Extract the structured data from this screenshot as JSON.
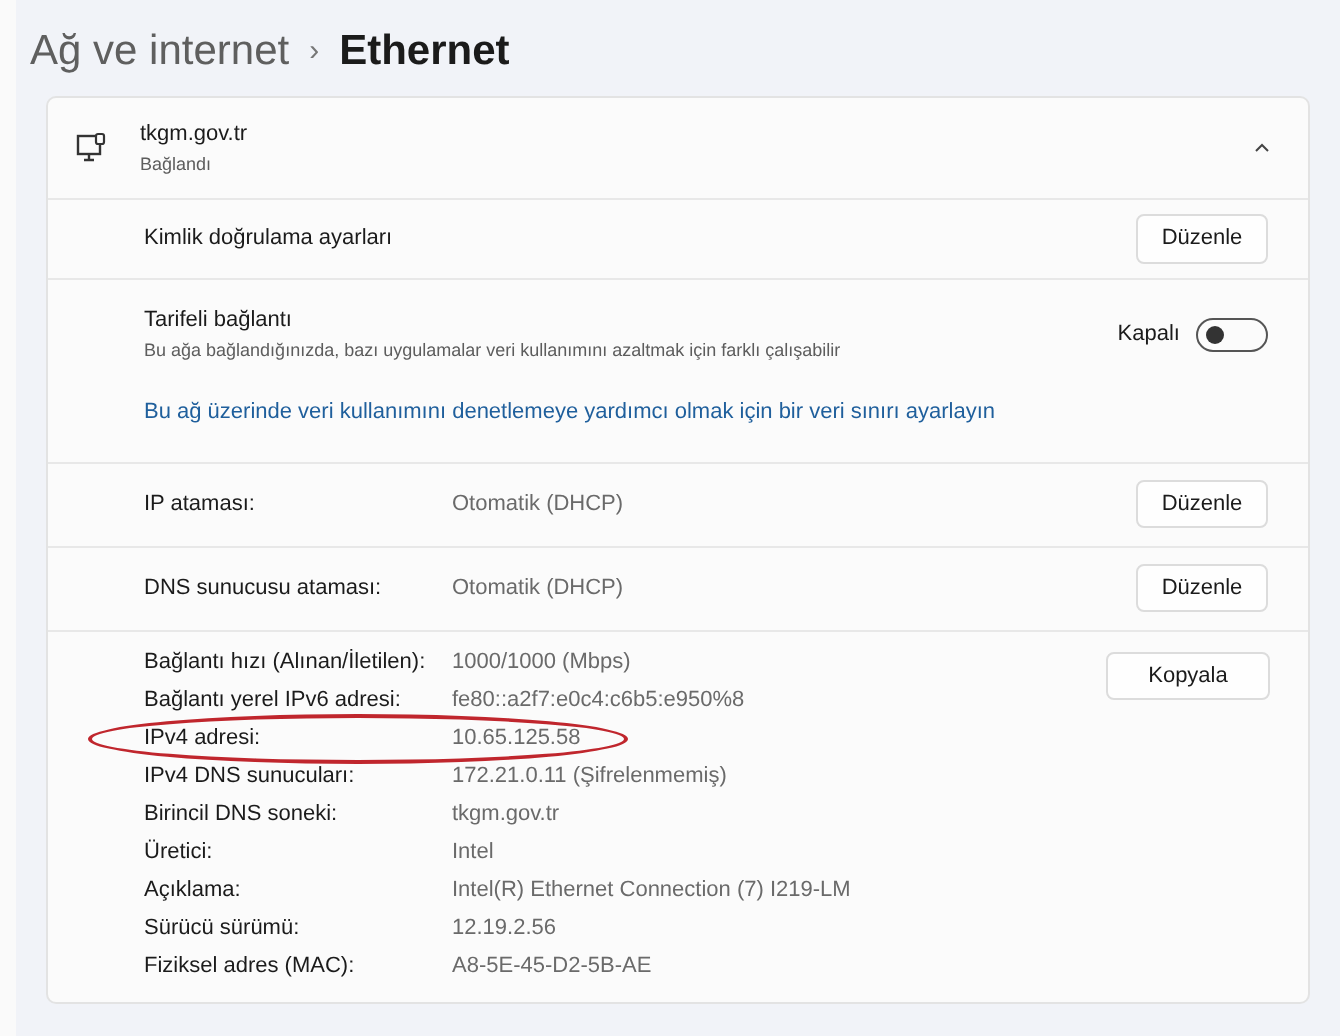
{
  "breadcrumb": {
    "parent": "Ağ ve internet",
    "separator": "›",
    "current": "Ethernet"
  },
  "network": {
    "name": "tkgm.gov.tr",
    "status": "Bağlandı",
    "expanded": true
  },
  "auth": {
    "label": "Kimlik doğrulama ayarları",
    "button": "Düzenle"
  },
  "metered": {
    "label": "Tarifeli bağlantı",
    "description": "Bu ağa bağlandığınızda, bazı uygulamalar veri kullanımını azaltmak için farklı çalışabilir",
    "state_label": "Kapalı",
    "on": false,
    "link": "Bu ağ üzerinde veri kullanımını denetlemeye yardımcı olmak için bir veri sınırı ayarlayın"
  },
  "assignments": [
    {
      "label": "IP ataması:",
      "value": "Otomatik (DHCP)",
      "button": "Düzenle"
    },
    {
      "label": "DNS sunucusu ataması:",
      "value": "Otomatik (DHCP)",
      "button": "Düzenle"
    }
  ],
  "copy_button": "Kopyala",
  "properties": [
    {
      "label": "Bağlantı hızı (Alınan/İletilen):",
      "value": "1000/1000 (Mbps)",
      "circled": false
    },
    {
      "label": "Bağlantı yerel IPv6 adresi:",
      "value": "fe80::a2f7:e0c4:c6b5:e950%8",
      "circled": false
    },
    {
      "label": "IPv4 adresi:",
      "value": "10.65.125.58",
      "circled": true
    },
    {
      "label": "IPv4 DNS sunucuları:",
      "value": "172.21.0.11 (Şifrelenmemiş)",
      "circled": false
    },
    {
      "label": "Birincil DNS soneki:",
      "value": "tkgm.gov.tr",
      "circled": false
    },
    {
      "label": "Üretici:",
      "value": "Intel",
      "circled": false
    },
    {
      "label": "Açıklama:",
      "value": "Intel(R) Ethernet Connection (7) I219-LM",
      "circled": false
    },
    {
      "label": "Sürücü sürümü:",
      "value": "12.19.2.56",
      "circled": false
    },
    {
      "label": "Fiziksel adres (MAC):",
      "value": "A8-5E-45-D2-5B-AE",
      "circled": false
    }
  ]
}
